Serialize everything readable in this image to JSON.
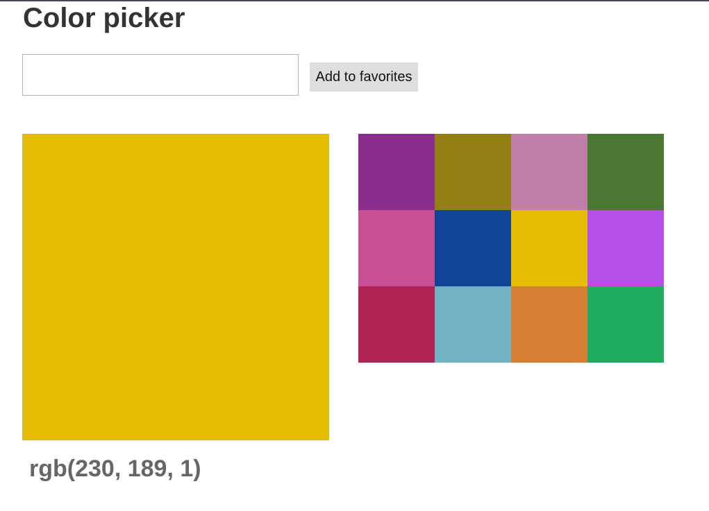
{
  "page": {
    "title": "Color picker"
  },
  "input": {
    "value": "",
    "placeholder": ""
  },
  "button": {
    "label": "Add to favorites"
  },
  "current_color": {
    "hex": "#e6bd01",
    "label": "rgb(230, 189, 1)"
  },
  "favorites": [
    "#8b2d8f",
    "#957f14",
    "#c07fa9",
    "#4a7731",
    "#c94f94",
    "#114496",
    "#e6bd01",
    "#b250e7",
    "#b02455",
    "#71b3c3",
    "#d47f35",
    "#21ad60"
  ]
}
